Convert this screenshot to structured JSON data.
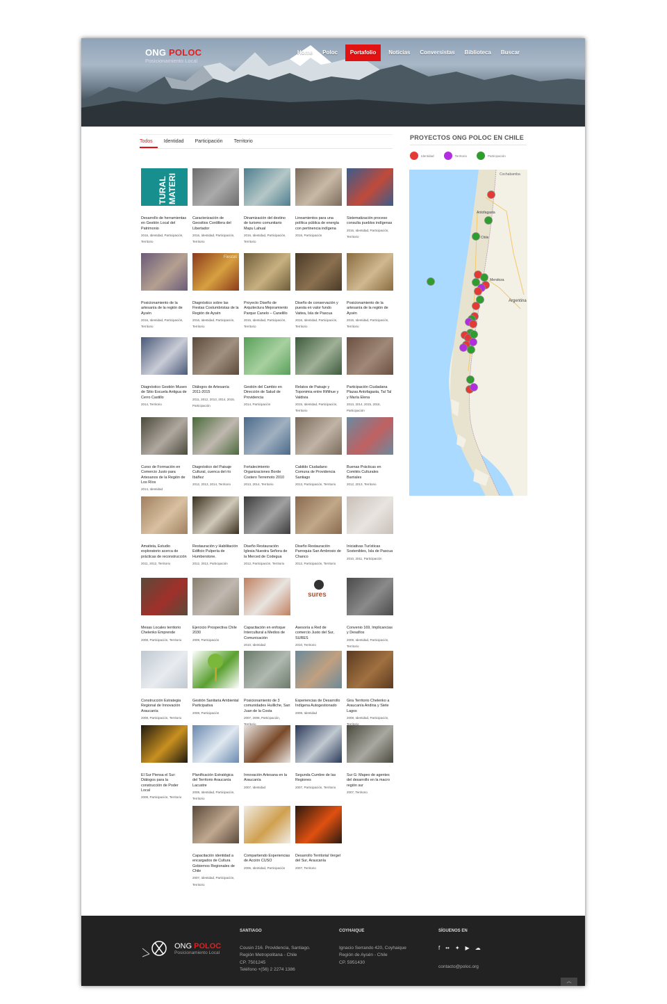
{
  "header": {
    "logo_name_a": "ONG ",
    "logo_name_b": "POLOC",
    "logo_sub": "Posicionamiento Local",
    "nav": [
      "Home",
      "Poloc",
      "Portafolio",
      "Noticias",
      "Conversistas",
      "Biblioteca",
      "Buscar"
    ],
    "nav_active": "Portafolio"
  },
  "filters": [
    "Todos",
    "Identidad",
    "Participación",
    "Territorio"
  ],
  "filter_active": "Todos",
  "sidebar": {
    "title": "PROYECTOS ONG POLOC EN CHILE",
    "legend": [
      {
        "label": "Identidad",
        "color": "#e53935"
      },
      {
        "label": "Territorio",
        "color": "#b32de0"
      },
      {
        "label": "Participación",
        "color": "#2e9d2e"
      }
    ],
    "map_labels": [
      "Cochabamba",
      "Antofagasta",
      "Chile",
      "Mendoza",
      "Argentina"
    ]
  },
  "projects": [
    {
      "title": "Desarrollo de herramientas en Gestión Local del Patrimonio",
      "meta": "2016, Identidad, Participación, Territorio"
    },
    {
      "title": "Caracterización de Geositios Cordillera del Libertador",
      "meta": "2016, Identidad, Participación, Territorio"
    },
    {
      "title": "Dinamización del destino de turismo comunitario Mapu Lahual",
      "meta": "2016, Identidad, Participación, Territorio"
    },
    {
      "title": "Lineamientos para una política pública de energía con pertinencia indígena",
      "meta": "2016, Participación"
    },
    {
      "title": "Sistematización proceso consulta pueblos indígenas",
      "meta": "2016, Identidad, Participación, Territorio"
    },
    {
      "title": "Posicionamiento de la artesanía de la región de Aysén",
      "meta": "2016, Identidad, Participación, Territorio"
    },
    {
      "title": "Diagnóstico sobre las Fiestas Costumbristas de la Región de Aysén",
      "meta": "2016, Identidad, Participación, Territorio"
    },
    {
      "title": "Proyecto Diseño de Arquitectura Mejoramiento Parque Canelo – Canelillo",
      "meta": "2015, Identidad, Participación, Territorio"
    },
    {
      "title": "Diseño de conservación y puesta en valor fundo Vaitea, Isla de Pascua",
      "meta": "2016, Identidad, Participación, Territorio"
    },
    {
      "title": "Posicionamiento de la artesanía de la región de Aysén",
      "meta": "2015, Identidad, Participación, Territorio"
    },
    {
      "title": "Diagnóstico Gestión Museo de Sitio Escuela Antigua de Cerro Castillo",
      "meta": "2014, Territorio"
    },
    {
      "title": "Diálogos de Artesanía 2011-2015",
      "meta": "2011, 2012, 2013, 2014, 2015, Participación"
    },
    {
      "title": "Gestión del Cambio en Dirección de Salud de Providencia",
      "meta": "2014, Participación"
    },
    {
      "title": "Relatos de Paisaje y Toponimia entre Riñihue y Valdivia",
      "meta": "2015, Identidad, Participación, Territorio"
    },
    {
      "title": "Participación Ciudadana Plazas Antofagasta, Tal Tal y María Elena",
      "meta": "2013, 2014, 2015, 2016, Participación"
    },
    {
      "title": "Curso de Formación en Comercio Justo para Artesanos de la Región de Los Ríos",
      "meta": "2014, Identidad"
    },
    {
      "title": "Diagnóstico del Paisaje Cultural, cuenca del río Ibáñez",
      "meta": "2012, 2013, 2014, Territorio"
    },
    {
      "title": "Fortalecimiento Organizaciones Borde Costero Terremoto 2010",
      "meta": "2013, 2014, Territorio"
    },
    {
      "title": "Cabildo Ciudadano Comuna de Providencia Santiago",
      "meta": "2013, Participación, Territorio"
    },
    {
      "title": "Buenas Prácticas en Comités Culturales Barriales",
      "meta": "2012, 2013, Territorio"
    },
    {
      "title": "Amatista, Estudio exploratorio acerca de prácticas de reconstrucción",
      "meta": "2011, 2012, Territorio"
    },
    {
      "title": "Restauración y Habilitación Edificio Pulpería de Humberstone.",
      "meta": "2012, 2013, Participación"
    },
    {
      "title": "Diseño Restauración Iglesia Nuestra Señora de la Merced de Codegua",
      "meta": "2012, Participación, Territorio"
    },
    {
      "title": "Diseño Restauración Parroquia San Ambrosio de Chanco",
      "meta": "2012, Participación, Territorio"
    },
    {
      "title": "Iniciativas Turísticas Sostenibles, Isla de Pascua",
      "meta": "2010, 2011, Participación"
    },
    {
      "title": "Mesas Locales territorio Chelenko Emprende",
      "meta": "2008, Participación, Territorio"
    },
    {
      "title": "Ejercicio Prospectiva Chile 2030",
      "meta": "2009, Participación"
    },
    {
      "title": "Capacitación en enfoque Intercultural a Medios de Comunicación",
      "meta": "2010, Identidad"
    },
    {
      "title": "Asesoría a Red de comercio Justo del Sur, SURES",
      "meta": "2010, Territorio"
    },
    {
      "title": "Convenio 169, Implicancias y Desafíos",
      "meta": "2009, Identidad, Participación, Territorio"
    },
    {
      "title": "Construcción Estrategia Regional de Innovación Araucanía",
      "meta": "2008, Participación, Territorio"
    },
    {
      "title": "Gestión Sanitaria Ambiental Participativa",
      "meta": "2008, Participación"
    },
    {
      "title": "Posicionamiento de 3 comunidades Huilliche, San Juan de la Costa",
      "meta": "2007, 2008, Participación, Territorio"
    },
    {
      "title": "Experiencias de Desarrollo Indígena Autogestionado",
      "meta": "2008, Identidad"
    },
    {
      "title": "Gira Territorio Chelenko a Araucanía Andina y Siete Lagos",
      "meta": "2008, Identidad, Participación, Territorio"
    },
    {
      "title": "El Sur Piensa el Sur: Diálogos para la construcción de Poder Local",
      "meta": "2008, Participación, Territorio"
    },
    {
      "title": "Planificación Estratégica del Territorio Araucanía Lacustre",
      "meta": "2008, Identidad, Participación, Territorio"
    },
    {
      "title": "Innovación Artesana en la Araucanía",
      "meta": "2007, Identidad"
    },
    {
      "title": "Segunda Cumbre de las Regiones",
      "meta": "2007, Participación, Territorio"
    },
    {
      "title": "Sur G: Mapeo de agentes del desarrollo en la macro región sur",
      "meta": "2007, Territorio"
    },
    {
      "title": "Capacitación identidad a encargados de Cultura Gobiernos Regionales de Chile",
      "meta": "2007, Identidad, Participación, Territorio"
    },
    {
      "title": "Compartiendo Experiencias de Acción CUSO",
      "meta": "2006, Identidad, Participación"
    },
    {
      "title": "Desarrollo Territorial Vergel del Sur, Araucanía",
      "meta": "2007, Territorio"
    }
  ],
  "thumb_texts": {
    "patrimonio": "TURAL MATERI",
    "sures": "sures",
    "fiestas": "Fiestas"
  },
  "footer": {
    "logo_a": "ONG ",
    "logo_b": "POLOC",
    "logo_sub": "Posicionamiento Local",
    "santiago_h": "SANTIAGO",
    "santiago_lines": [
      "Cousin 216. Providencia, Santiago.",
      "Región Metropolitana - Chile",
      "CP. 7501245",
      "Teléfono +(56) 2 2274 1386"
    ],
    "coyhaique_h": "COYHAIQUE",
    "coyhaique_lines": [
      "Ignacio Serrando 420, Coyhaique",
      "Región de Aysén - Chile",
      "CP. 5951430"
    ],
    "follow_h": "SÍGUENOS EN",
    "email": "contacto@poloc.org",
    "social_icons": [
      "facebook-icon",
      "flickr-icon",
      "twitter-icon",
      "youtube-icon",
      "soundcloud-icon"
    ]
  }
}
